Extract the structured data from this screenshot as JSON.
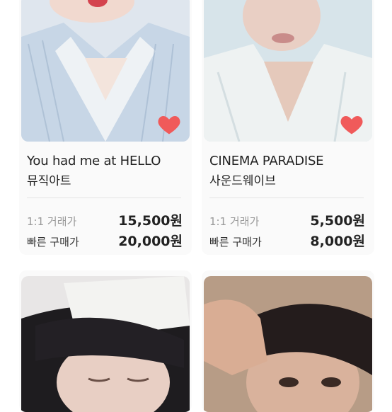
{
  "colors": {
    "card_bg": "#fafafa",
    "heart": "#f05a5a",
    "divider": "#e3e3e3"
  },
  "products": [
    {
      "title": "You had me at HELLO",
      "artist": "뮤직아트",
      "trade_label": "1:1 거래가",
      "trade_price": "15,500원",
      "buy_label": "빠른 구매가",
      "buy_price": "20,000원",
      "liked": true
    },
    {
      "title": "CINEMA PARADISE",
      "artist": "사운드웨이브",
      "trade_label": "1:1 거래가",
      "trade_price": "5,500원",
      "buy_label": "빠른 구매가",
      "buy_price": "8,000원",
      "liked": true
    },
    {
      "liked": false
    },
    {
      "liked": false
    }
  ],
  "icons": {
    "like": "heart-icon"
  }
}
